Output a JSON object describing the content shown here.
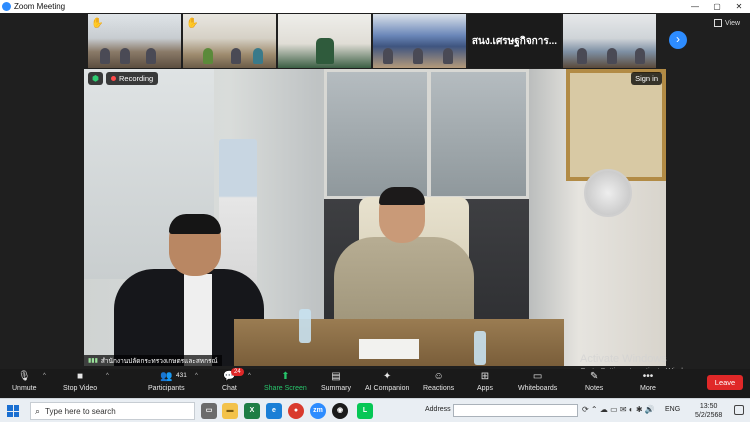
{
  "window": {
    "title": "Zoom Meeting",
    "minimize": "—",
    "maximize": "▢",
    "close": "✕"
  },
  "gallery": {
    "label_tile": "สนง.เศรษฐกิจการ...",
    "next_icon": "chevron-right-icon",
    "view_label": "View"
  },
  "speaker": {
    "recording_label": "Recording",
    "sign_in_label": "Sign in",
    "name": "สำนักงานปลัดกระทรวงเกษตรและสหกรณ์"
  },
  "watermark": {
    "line1": "Activate Windows",
    "line2": "Go to Settings to activate Windows."
  },
  "controls": {
    "unmute": "Unmute",
    "stop_video": "Stop Video",
    "participants": "Participants",
    "participants_count": "431",
    "chat": "Chat",
    "chat_badge": "24",
    "share_screen": "Share Screen",
    "summary": "Summary",
    "ai_companion": "AI Companion",
    "reactions": "Reactions",
    "apps": "Apps",
    "whiteboards": "Whiteboards",
    "notes": "Notes",
    "more": "More",
    "leave": "Leave"
  },
  "taskbar": {
    "search_placeholder": "Type here to search",
    "address_label": "Address",
    "language": "ENG",
    "time": "13:50",
    "date": "5/2/2568"
  },
  "colors": {
    "accent": "#2d8cff",
    "leave": "#e02828",
    "share": "#27c46b"
  }
}
